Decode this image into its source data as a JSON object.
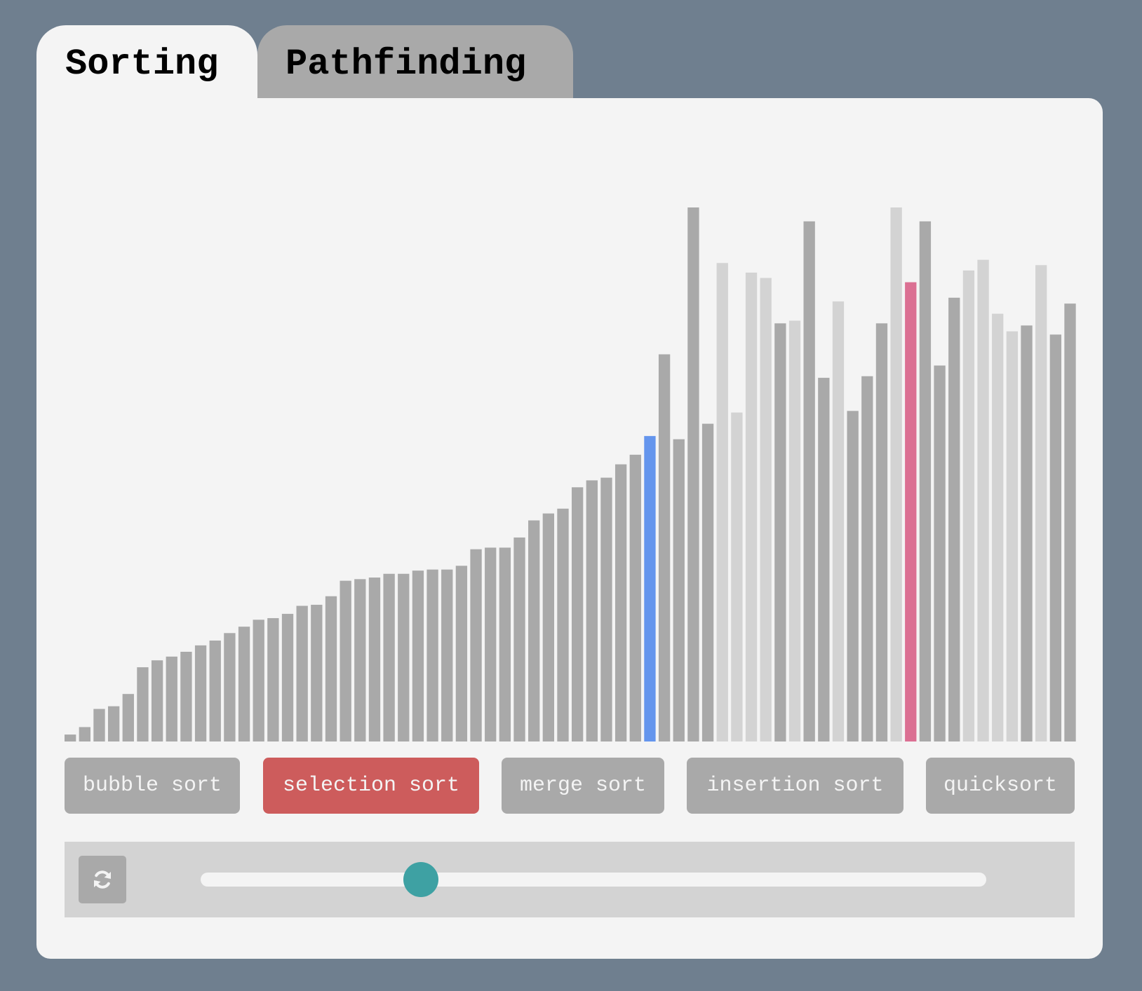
{
  "tabs": [
    {
      "label": "Sorting",
      "active": true
    },
    {
      "label": "Pathfinding",
      "active": false
    }
  ],
  "chart_data": {
    "type": "bar",
    "values": [
      1.3,
      2.7,
      6.1,
      6.6,
      8.9,
      13.9,
      15.2,
      15.9,
      16.8,
      18.0,
      18.9,
      20.3,
      21.5,
      22.8,
      23.1,
      23.9,
      25.4,
      25.6,
      27.2,
      30.1,
      30.4,
      30.7,
      31.4,
      31.4,
      32.0,
      32.2,
      32.2,
      32.9,
      36.0,
      36.3,
      36.3,
      38.2,
      41.4,
      42.7,
      43.6,
      47.6,
      48.9,
      49.4,
      51.9,
      53.7,
      57.2,
      72.5,
      56.6,
      100.0,
      59.5,
      89.6,
      61.6,
      87.8,
      86.8,
      78.3,
      78.8,
      97.4,
      68.1,
      82.4,
      61.9,
      68.4,
      78.3,
      100.0,
      86.0,
      97.4,
      70.4,
      83.1,
      88.2,
      90.2,
      80.1,
      76.8,
      77.9,
      89.2,
      76.2,
      82.0
    ],
    "states": [
      "sorted",
      "sorted",
      "sorted",
      "sorted",
      "sorted",
      "sorted",
      "sorted",
      "sorted",
      "sorted",
      "sorted",
      "sorted",
      "sorted",
      "sorted",
      "sorted",
      "sorted",
      "sorted",
      "sorted",
      "sorted",
      "sorted",
      "sorted",
      "sorted",
      "sorted",
      "sorted",
      "sorted",
      "sorted",
      "sorted",
      "sorted",
      "sorted",
      "sorted",
      "sorted",
      "sorted",
      "sorted",
      "sorted",
      "sorted",
      "sorted",
      "sorted",
      "sorted",
      "sorted",
      "sorted",
      "sorted",
      "current",
      "unsorted",
      "unsorted",
      "unsorted",
      "unsorted",
      "scanned",
      "scanned",
      "scanned",
      "scanned",
      "unsorted",
      "scanned",
      "unsorted",
      "unsorted",
      "scanned",
      "unsorted",
      "unsorted",
      "unsorted",
      "scanned",
      "compare",
      "unsorted",
      "unsorted",
      "unsorted",
      "scanned",
      "scanned",
      "scanned",
      "scanned",
      "unsorted",
      "scanned",
      "unsorted",
      "unsorted"
    ],
    "ylim": [
      0,
      100
    ],
    "colors": {
      "sorted": "#a9a9a9",
      "unsorted": "#a9a9a9",
      "scanned": "#d3d3d3",
      "current": "#6495ed",
      "compare": "#db7093"
    },
    "title": "",
    "xlabel": "",
    "ylabel": ""
  },
  "algorithms": [
    {
      "label": "bubble sort",
      "active": false
    },
    {
      "label": "selection sort",
      "active": true
    },
    {
      "label": "merge sort",
      "active": false
    },
    {
      "label": "insertion sort",
      "active": false
    },
    {
      "label": "quicksort",
      "active": false
    }
  ],
  "controls": {
    "refresh_icon": "refresh-icon",
    "speed_fraction": 0.28
  },
  "colors": {
    "background": "#6f7f8f",
    "panel": "#f4f4f4",
    "button": "#a9a9a9",
    "button_active": "#cd5c5c",
    "control_bar": "#d3d3d3",
    "slider_thumb": "#3ea1a3"
  }
}
